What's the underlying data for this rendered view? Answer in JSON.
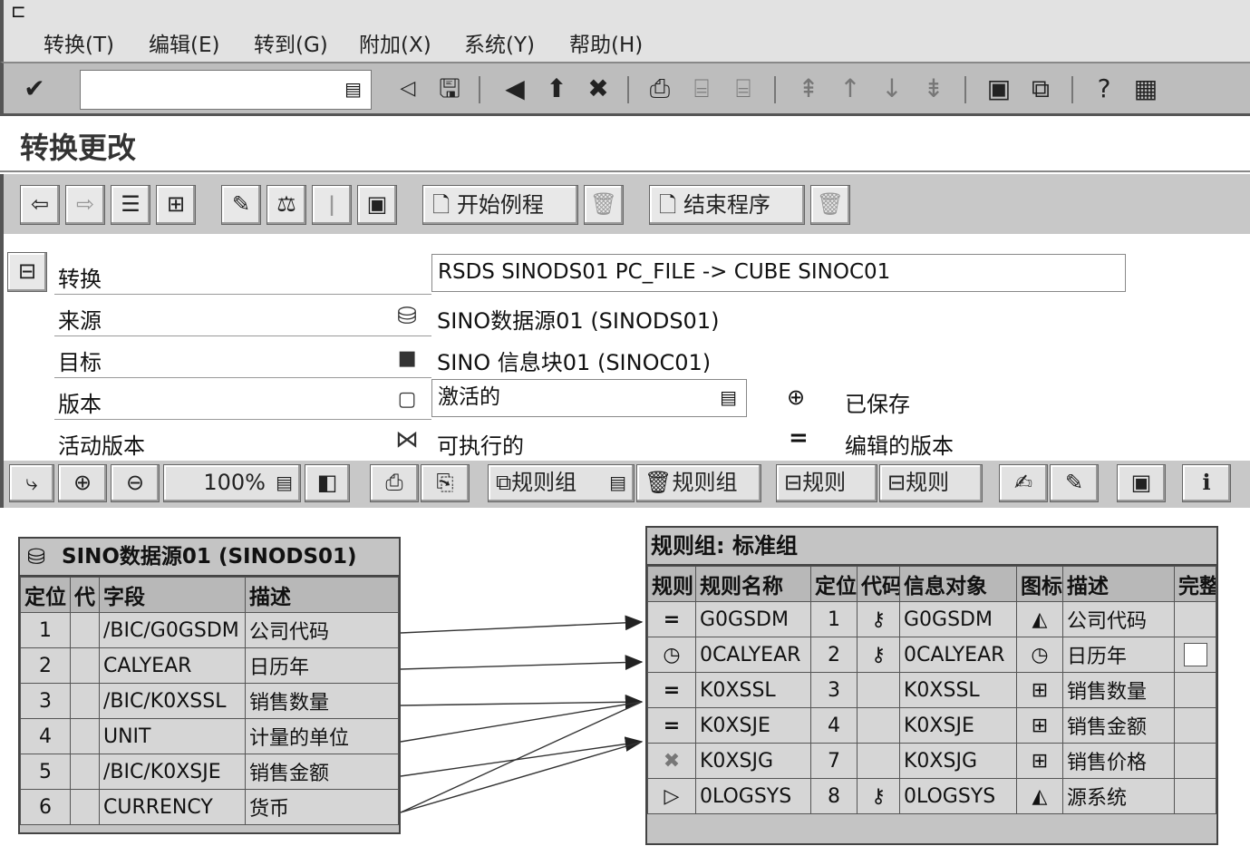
{
  "menu": {
    "items": [
      "转换(T)",
      "编辑(E)",
      "转到(G)",
      "附加(X)",
      "系统(Y)",
      "帮助(H)"
    ]
  },
  "title": "转换更改",
  "app_toolbar": {
    "start_routine": "开始例程",
    "end_routine": "结束程序"
  },
  "header": {
    "transformation_label": "转换",
    "transformation_value": "RSDS SINODS01 PC_FILE -> CUBE SINOC01",
    "source_label": "来源",
    "source_value": "SINO数据源01 (SINODS01)",
    "target_label": "目标",
    "target_value": "SINO 信息块01 (SINOC01)",
    "version_label": "版本",
    "version_value": "激活的",
    "saved_status": "已保存",
    "active_version_label": "活动版本",
    "active_version_value": "可执行的",
    "edited_version": "编辑的版本"
  },
  "graph_toolbar": {
    "zoom": "100%",
    "rule_group_label": "规则组",
    "rule_group_delete_label": "规则组",
    "rule_label_1": "规则",
    "rule_label_2": "规则"
  },
  "source_table": {
    "title": "SINO数据源01 (SINODS01)",
    "headers": [
      "定位",
      "代",
      "字段",
      "描述"
    ],
    "rows": [
      {
        "pos": "1",
        "field": "/BIC/G0GSDM",
        "desc": "公司代码"
      },
      {
        "pos": "2",
        "field": "CALYEAR",
        "desc": "日历年"
      },
      {
        "pos": "3",
        "field": "/BIC/K0XSSL",
        "desc": "销售数量"
      },
      {
        "pos": "4",
        "field": "UNIT",
        "desc": "计量的单位"
      },
      {
        "pos": "5",
        "field": "/BIC/K0XSJE",
        "desc": "销售金额"
      },
      {
        "pos": "6",
        "field": "CURRENCY",
        "desc": "货币"
      }
    ]
  },
  "rule_group": {
    "title": "规则组: 标准组",
    "headers": [
      "规则",
      "规则名称",
      "定位",
      "代码",
      "信息对象",
      "图标",
      "描述",
      "完整"
    ],
    "rows": [
      {
        "rule_icon": "=",
        "name": "G0GSDM",
        "pos": "1",
        "key": true,
        "obj": "G0GSDM",
        "obj_icon": "char",
        "desc": "公司代码"
      },
      {
        "rule_icon": "clock",
        "name": "0CALYEAR",
        "pos": "2",
        "key": true,
        "obj": "0CALYEAR",
        "obj_icon": "time",
        "desc": "日历年"
      },
      {
        "rule_icon": "=",
        "name": "K0XSSL",
        "pos": "3",
        "key": false,
        "obj": "K0XSSL",
        "obj_icon": "kf",
        "desc": "销售数量"
      },
      {
        "rule_icon": "=",
        "name": "K0XSJE",
        "pos": "4",
        "key": false,
        "obj": "K0XSJE",
        "obj_icon": "kf",
        "desc": "销售金额"
      },
      {
        "rule_icon": "x",
        "name": "K0XSJG",
        "pos": "7",
        "key": false,
        "obj": "K0XSJG",
        "obj_icon": "kf",
        "desc": "销售价格"
      },
      {
        "rule_icon": "play",
        "name": "0LOGSYS",
        "pos": "8",
        "key": true,
        "obj": "0LOGSYS",
        "obj_icon": "char",
        "desc": "源系统"
      }
    ]
  },
  "colors": {
    "toolbar": "#c8c8c8",
    "table_bg": "#d6d6d6",
    "border": "#444444"
  }
}
